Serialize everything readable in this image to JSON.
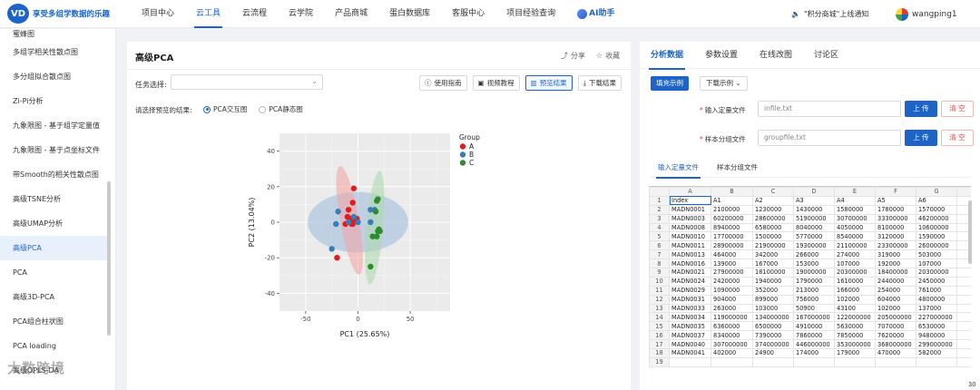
{
  "brand": {
    "logo_mark": "VD",
    "name": "享受多组学数据的乐趣"
  },
  "nav": [
    {
      "label": "项目中心"
    },
    {
      "label": "云工具"
    },
    {
      "label": "云流程"
    },
    {
      "label": "云学院"
    },
    {
      "label": "产品商城"
    },
    {
      "label": "蛋白数据库"
    },
    {
      "label": "客服中心"
    },
    {
      "label": "项目经验查询"
    }
  ],
  "ai_label": "AI助手",
  "notice": "\"积分商城\"上线通知",
  "username": "wangping1",
  "sidebar": {
    "items": [
      {
        "label": "蜜蜂图"
      },
      {
        "label": "多组学相关性散点图"
      },
      {
        "label": "多分组拟合散点图"
      },
      {
        "label": "Zi-Pi分析"
      },
      {
        "label": "九象限图 - 基于组学定量值"
      },
      {
        "label": "九象限图 - 基于点坐标文件"
      },
      {
        "label": "带Smooth的相关性散点图"
      },
      {
        "label": "高级TSNE分析"
      },
      {
        "label": "高级UMAP分析"
      },
      {
        "label": "高级PCA"
      },
      {
        "label": "PCA"
      },
      {
        "label": "高级3D-PCA"
      },
      {
        "label": "PCA组合柱状图"
      },
      {
        "label": "PCA loading"
      },
      {
        "label": "高级OPLS-DA"
      }
    ]
  },
  "watermark": "大数跨境",
  "main": {
    "title": "高级PCA",
    "share_label": "分享",
    "fav_label": "收藏",
    "task_label": "任务选择:",
    "buttons": {
      "guide": "使用指南",
      "video": "视频教程",
      "preview": "预览结果",
      "download": "下载结果"
    },
    "preview_label": "请选择预览的结果:",
    "radio_interactive": "PCA交互图",
    "radio_static": "PCA静态图"
  },
  "chart_data": {
    "type": "scatter",
    "xlabel": "PC1 (25.65%)",
    "ylabel": "PC2 (13.04%)",
    "xlim": [
      -75,
      88
    ],
    "ylim": [
      -50,
      50
    ],
    "xticks": [
      -50,
      0,
      50
    ],
    "yticks": [
      -40,
      -20,
      0,
      20,
      40
    ],
    "grid": true,
    "legend_title": "Group",
    "legend_position": "right",
    "series": [
      {
        "name": "A",
        "color": "#e41a1c",
        "points": [
          [
            -20,
            -20
          ],
          [
            -12,
            -1
          ],
          [
            -10,
            3
          ],
          [
            -9,
            7
          ],
          [
            -8,
            0
          ],
          [
            -7,
            2
          ],
          [
            -6,
            -1
          ],
          [
            -5,
            -1
          ],
          [
            -5,
            11
          ],
          [
            -4,
            19
          ],
          [
            -3,
            1
          ],
          [
            -1,
            2
          ]
        ]
      },
      {
        "name": "B",
        "color": "#377eb8",
        "points": [
          [
            -25,
            -15
          ],
          [
            -21,
            -1
          ],
          [
            -19,
            6
          ],
          [
            -9,
            0
          ],
          [
            -4,
            3
          ],
          [
            0,
            0
          ],
          [
            12,
            7
          ],
          [
            16,
            7
          ],
          [
            12,
            0
          ]
        ]
      },
      {
        "name": "C",
        "color": "#2e8b2e",
        "points": [
          [
            12,
            -25
          ],
          [
            14,
            -8
          ],
          [
            18,
            -8
          ],
          [
            19,
            -5
          ],
          [
            20,
            -4
          ],
          [
            21,
            -5
          ],
          [
            17,
            6
          ],
          [
            19,
            13
          ],
          [
            18,
            12
          ]
        ]
      }
    ],
    "ellipses": [
      {
        "group": "all",
        "color": "#9cb9dc",
        "cx": 0,
        "cy": 0,
        "rx": 48,
        "ry": 17,
        "angle": 0
      },
      {
        "group": "A",
        "color": "#f4a3a3",
        "cx": -8,
        "cy": 1,
        "rx": 9,
        "ry": 31,
        "angle": -10
      },
      {
        "group": "C",
        "color": "#a9d8a9",
        "cx": 16,
        "cy": -3,
        "rx": 8,
        "ry": 32,
        "angle": 5
      }
    ]
  },
  "right": {
    "tabs": [
      {
        "label": "分析数据"
      },
      {
        "label": "参数设置"
      },
      {
        "label": "在线改图"
      },
      {
        "label": "讨论区"
      }
    ],
    "fill_example": "填充示例",
    "download_example": "下载示例",
    "quant_label": "输入定量文件",
    "quant_file": "infile.txt",
    "group_label": "样本分组文件",
    "group_file": "groupfile.txt",
    "upload": "上 传",
    "clear": "清 空",
    "subtabs": [
      {
        "label": "输入定量文件"
      },
      {
        "label": "样本分组文件"
      }
    ],
    "col_letters": [
      "A",
      "B",
      "C",
      "D",
      "E",
      "F",
      "G"
    ],
    "rows": [
      [
        "Index",
        "A1",
        "A2",
        "A3",
        "A4",
        "A5",
        "A6"
      ],
      [
        "MADN0001",
        "2100000",
        "1230000",
        "1430000",
        "1580000",
        "1780000",
        "1570000"
      ],
      [
        "MADN0003",
        "60200000",
        "28600000",
        "51900000",
        "30700000",
        "33300000",
        "46200000"
      ],
      [
        "MADN0008",
        "8940000",
        "6580000",
        "8040000",
        "4050000",
        "8100000",
        "10600000"
      ],
      [
        "MADN0010",
        "17700000",
        "1500000",
        "5770000",
        "8540000",
        "3120000",
        "1590000"
      ],
      [
        "MADN0011",
        "28900000",
        "21900000",
        "19300000",
        "21100000",
        "23300000",
        "26000000"
      ],
      [
        "MADN0013",
        "464000",
        "342000",
        "266000",
        "274000",
        "319000",
        "503000"
      ],
      [
        "MADN0016",
        "139000",
        "167000",
        "153000",
        "107000",
        "192000",
        "107000"
      ],
      [
        "MADN0021",
        "27900000",
        "18100000",
        "19000000",
        "20300000",
        "18400000",
        "20300000"
      ],
      [
        "MADN0024",
        "2420000",
        "1940000",
        "1790000",
        "1610000",
        "2440000",
        "2450000"
      ],
      [
        "MADN0029",
        "1090000",
        "352000",
        "213000",
        "166000",
        "254000",
        "761000"
      ],
      [
        "MADN0031",
        "904000",
        "899000",
        "756000",
        "102000",
        "604000",
        "4800000"
      ],
      [
        "MADN0033",
        "263000",
        "103000",
        "50900",
        "43100",
        "102000",
        "137000"
      ],
      [
        "MADN0034",
        "119000000",
        "134000000",
        "167000000",
        "122000000",
        "205000000",
        "227000000"
      ],
      [
        "MADN0035",
        "6360000",
        "6500000",
        "4910000",
        "5630000",
        "7070000",
        "6530000"
      ],
      [
        "MADN0037",
        "8340000",
        "7390000",
        "7860000",
        "7850000",
        "7620000",
        "9480000"
      ],
      [
        "MADN0040",
        "307000000",
        "374000000",
        "446000000",
        "353000000",
        "368000000",
        "299000000"
      ],
      [
        "MADN0041",
        "402000",
        "24900",
        "174000",
        "179000",
        "470000",
        "582000"
      ],
      [
        "",
        "",
        "",
        "",
        "",
        "",
        ""
      ]
    ],
    "corner_value": "30"
  }
}
